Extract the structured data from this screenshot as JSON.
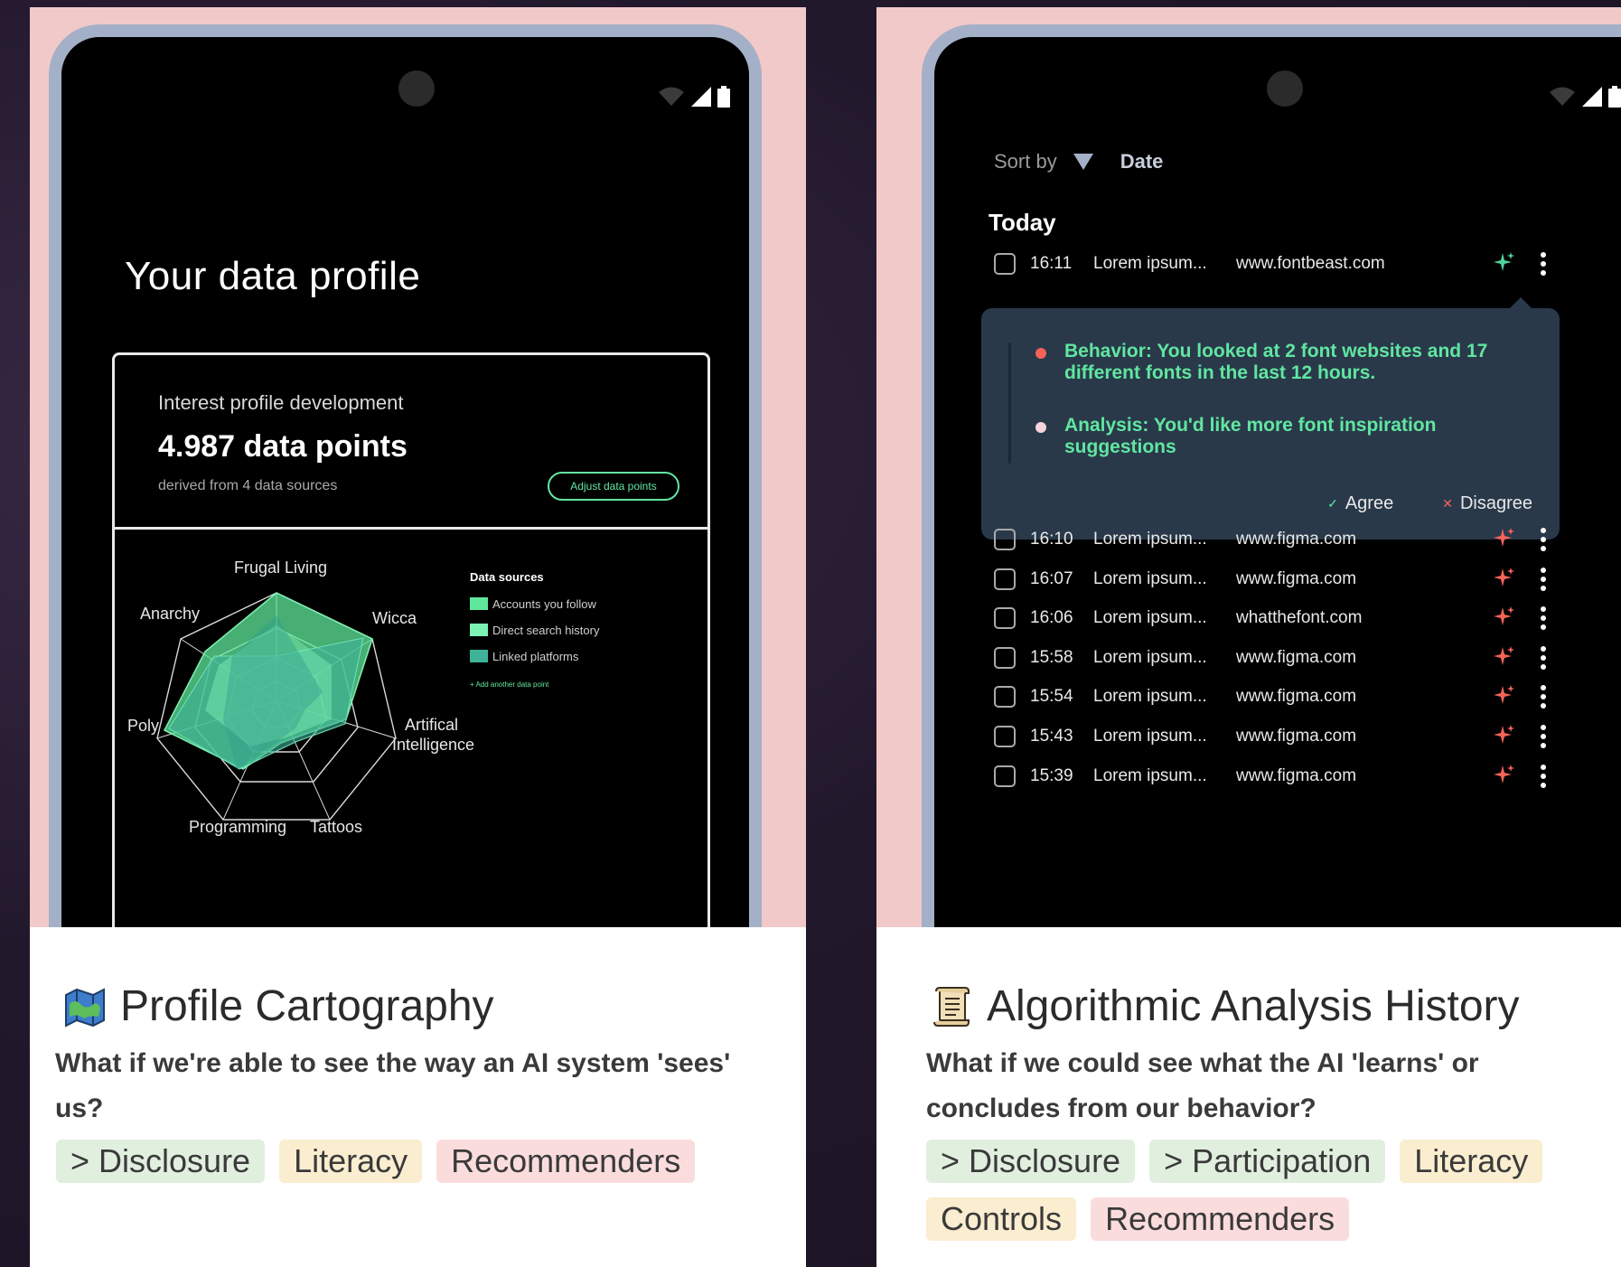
{
  "left_card": {
    "profile_title": "Your data profile",
    "interest_label": "Interest profile development",
    "data_points": "4.987 data points",
    "derived": "derived from 4 data sources",
    "adjust_button": "Adjust data points",
    "radar": {
      "axes": [
        "Frugal Living",
        "Wicca",
        "Artifical",
        "Intelligence",
        "Tattoos",
        "Programming",
        "Poly",
        "Anarchy"
      ],
      "legend_title": "Data sources",
      "legend_items": [
        "Accounts you follow",
        "Direct search history",
        "Linked platforms"
      ],
      "legend_add": "Add another data point",
      "colors": {
        "series1": "#5fe89b",
        "series2": "#3fb39a",
        "series3": "#7ef2b4"
      }
    },
    "title": "Profile Cartography",
    "icon": "map-icon",
    "description": "What if we're able to see the way an AI system 'sees' us?",
    "tags": [
      "> Disclosure",
      "Literacy",
      "Recommenders"
    ]
  },
  "right_card": {
    "sort_label": "Sort by",
    "sort_value": "Date",
    "section": "Today",
    "first_row": {
      "time": "16:11",
      "desc": "Lorem ipsum...",
      "site": "www.fontbeast.com"
    },
    "popup": {
      "behavior": "Behavior: You looked at 2 font websites and 17 different fonts in the last 12 hours.",
      "analysis": "Analysis: You'd like more font inspiration suggestions",
      "agree": "Agree",
      "disagree": "Disagree"
    },
    "rows": [
      {
        "time": "16:10",
        "desc": "Lorem ipsum...",
        "site": "www.figma.com"
      },
      {
        "time": "16:07",
        "desc": "Lorem ipsum...",
        "site": "www.figma.com"
      },
      {
        "time": "16:06",
        "desc": "Lorem ipsum...",
        "site": "whatthefont.com"
      },
      {
        "time": "15:58",
        "desc": "Lorem ipsum...",
        "site": "www.figma.com"
      },
      {
        "time": "15:54",
        "desc": "Lorem ipsum...",
        "site": "www.figma.com"
      },
      {
        "time": "15:43",
        "desc": "Lorem ipsum...",
        "site": "www.figma.com"
      },
      {
        "time": "15:39",
        "desc": "Lorem ipsum...",
        "site": "www.figma.com"
      }
    ],
    "title": "Algorithmic Analysis History",
    "icon": "scroll-icon",
    "description": "What if we could see what the AI 'learns' or concludes from our behavior?",
    "tags": [
      "> Disclosure",
      "> Participation",
      "Literacy",
      "Controls",
      "Recommenders"
    ]
  },
  "colors": {
    "accent_green": "#61e6a0",
    "accent_red": "#f4635a",
    "tag_green": "#e1efdf",
    "tag_yellow": "#faedd0",
    "tag_red": "#fbdcdc"
  }
}
